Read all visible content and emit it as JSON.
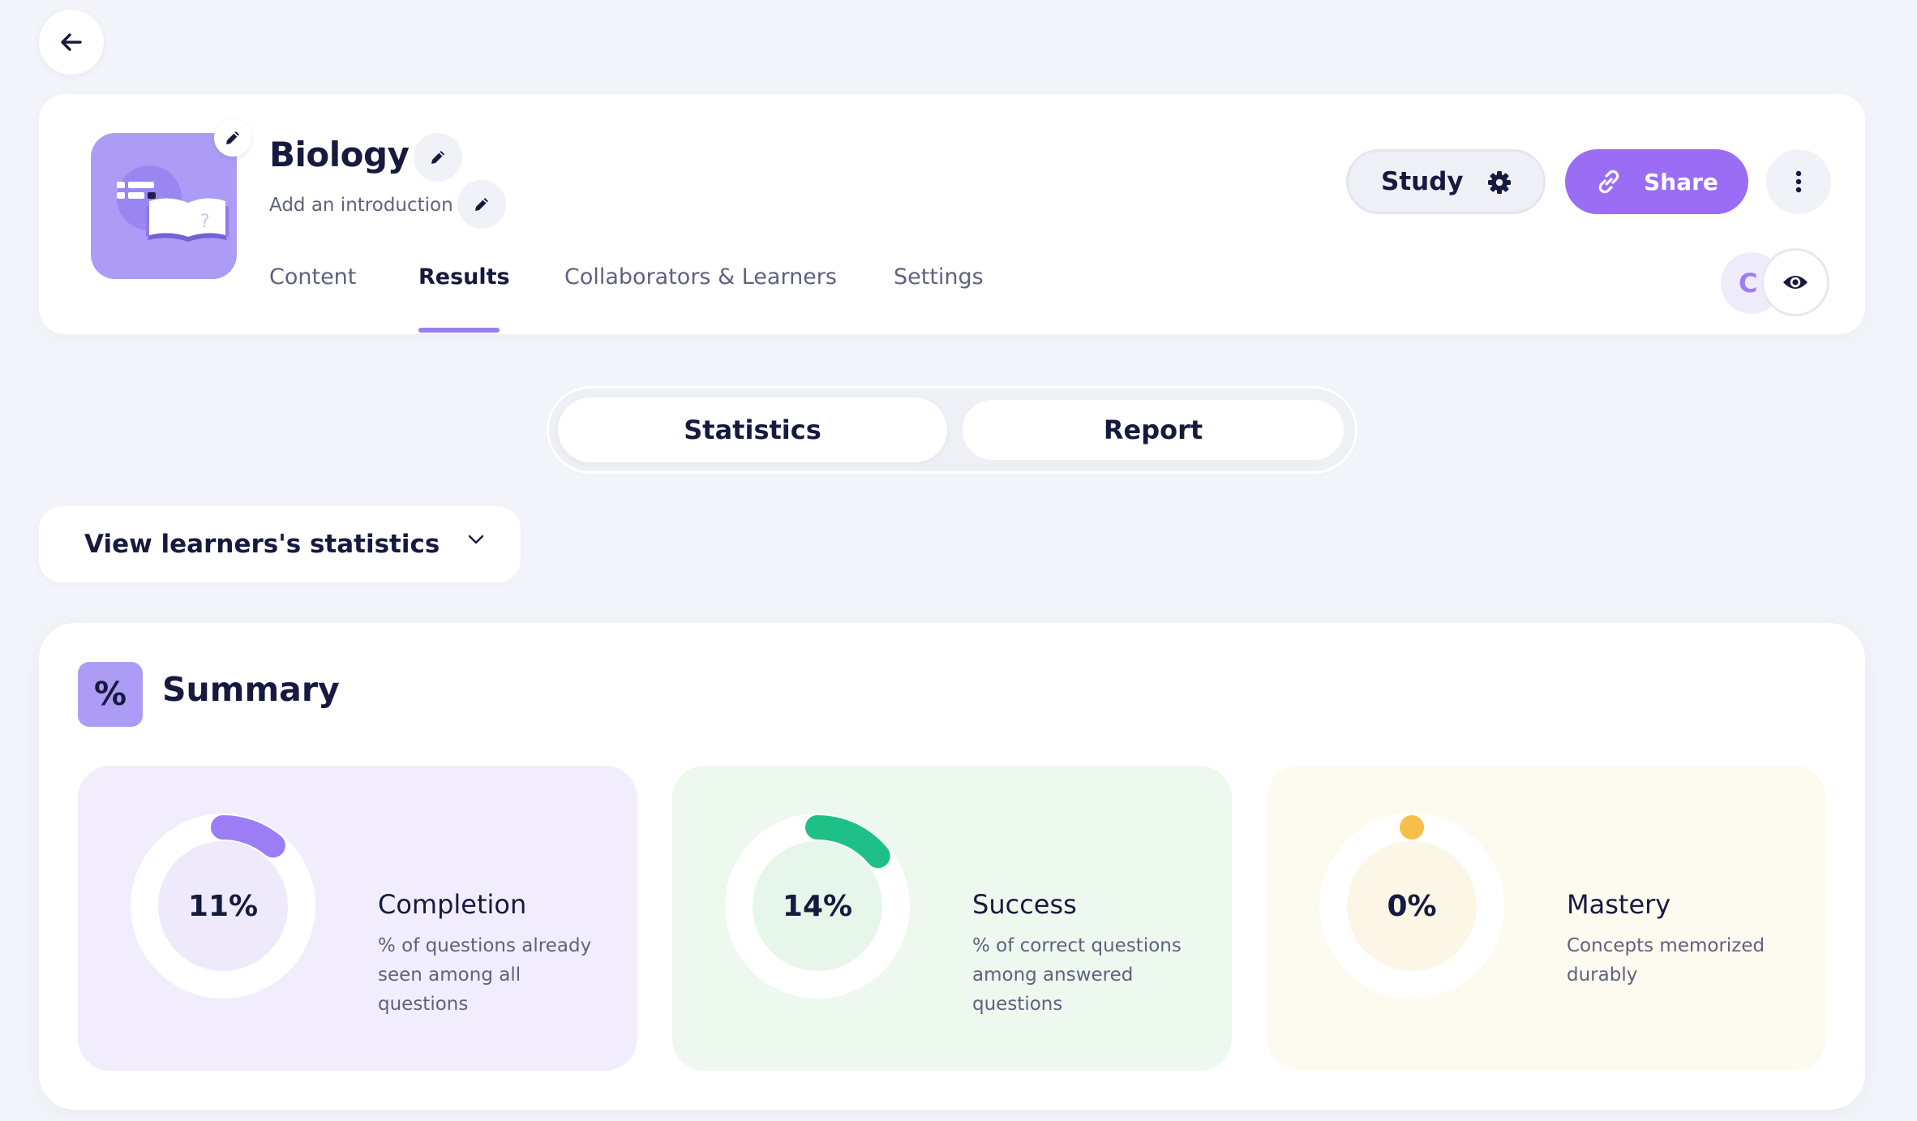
{
  "nav": {
    "back_icon": "arrow-left-icon"
  },
  "course": {
    "title": "Biology",
    "introduction_placeholder": "Add an introduction",
    "icon": "book-icon"
  },
  "tabs": [
    {
      "label": "Content",
      "active": false
    },
    {
      "label": "Results",
      "active": true
    },
    {
      "label": "Collaborators & Learners",
      "active": false
    },
    {
      "label": "Settings",
      "active": false
    }
  ],
  "actions": {
    "study_label": "Study",
    "share_label": "Share",
    "share_color": "#9b6df5"
  },
  "collaborators": {
    "avatar_initial": "C"
  },
  "view_switch": {
    "options": [
      "Statistics",
      "Report"
    ],
    "selected": "Statistics"
  },
  "learners_filter": {
    "label": "View learners's statistics"
  },
  "summary": {
    "badge": "%",
    "title": "Summary",
    "stats": [
      {
        "value": "11%",
        "fraction": 0.11,
        "label": "Completion",
        "description": "% of questions already seen among all questions",
        "accent": "#9b7ef6",
        "background": "#f1edfd"
      },
      {
        "value": "14%",
        "fraction": 0.14,
        "label": "Success",
        "description": "% of correct questions among answered questions",
        "accent": "#1fc088",
        "background": "#edf8ef"
      },
      {
        "value": "0%",
        "fraction": 0,
        "label": "Mastery",
        "description": "Concepts memorized durably",
        "accent": "#f6bf49",
        "background": "#fdfaf0"
      }
    ]
  }
}
